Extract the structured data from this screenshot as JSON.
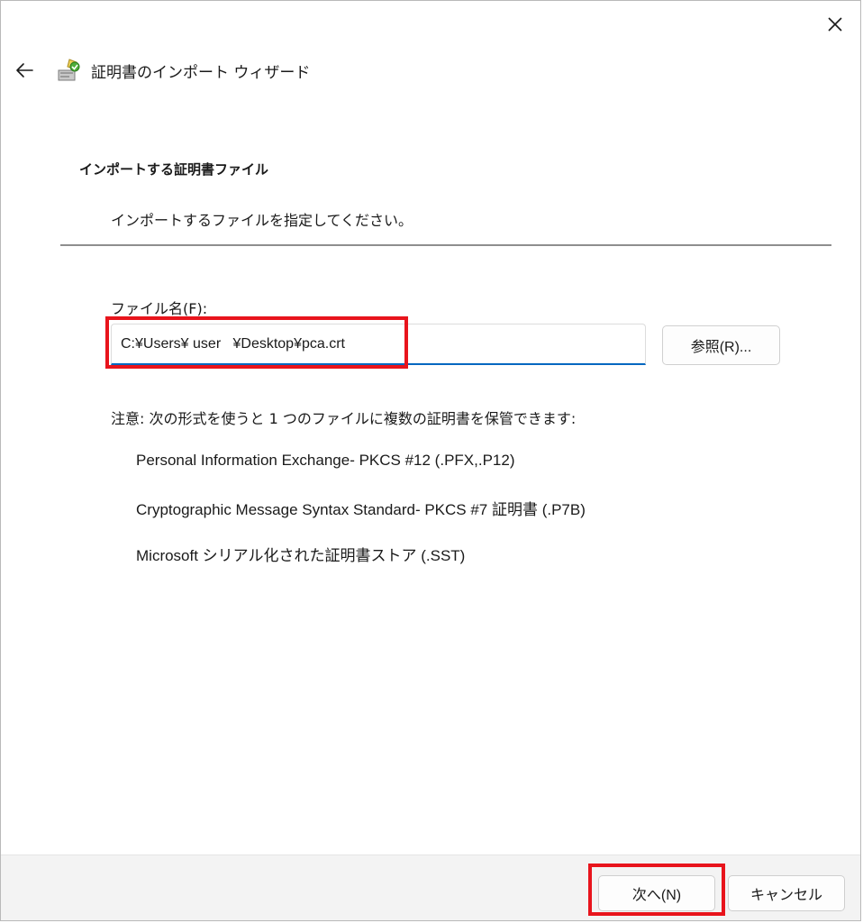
{
  "window": {
    "title": "証明書のインポート ウィザード"
  },
  "header": {
    "heading": "インポートする証明書ファイル",
    "subheading": "インポートするファイルを指定してください。"
  },
  "file": {
    "label": "ファイル名(F):",
    "value": "C:¥Users¥ user   ¥Desktop¥pca.crt",
    "browse_label": "参照(R)..."
  },
  "note": "注意: 次の形式を使うと 1 つのファイルに複数の証明書を保管できます:",
  "formats": [
    "Personal Information Exchange- PKCS #12 (.PFX,.P12)",
    "Cryptographic Message Syntax Standard- PKCS #7 証明書 (.P7B)",
    "Microsoft シリアル化された証明書ストア (.SST)"
  ],
  "footer": {
    "next_label": "次へ(N)",
    "cancel_label": "キャンセル"
  },
  "icons": {
    "close": "close-icon",
    "back": "back-arrow-icon",
    "wizard": "certificate-wizard-icon"
  },
  "colors": {
    "accent": "#0067c0",
    "highlight": "#e8141c"
  }
}
